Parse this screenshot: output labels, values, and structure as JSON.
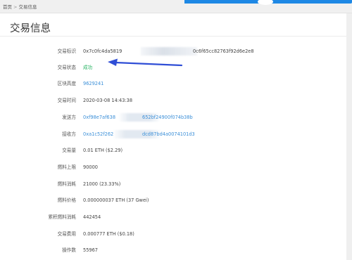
{
  "breadcrumb": {
    "home": "首页",
    "separator": ">",
    "current": "交易信息"
  },
  "page_title": "交易信息",
  "fields": {
    "tx_hash": {
      "label": "交易标识",
      "value_start": "0x7c0fc4da5819",
      "value_end": "0c6f65cc82763f92d6e2e8"
    },
    "status": {
      "label": "交易状态",
      "value": "成功"
    },
    "block_height": {
      "label": "区块高度",
      "value": "9629241"
    },
    "tx_time": {
      "label": "交易时间",
      "value": "2020-03-08 14:43:38"
    },
    "sender": {
      "label": "发送方",
      "value_start": "0xf98e7af638",
      "value_end": "652bf24900f074b38b"
    },
    "receiver": {
      "label": "接收方",
      "value_start": "0xa1c52f262",
      "value_end": "dcd87bd4a0074101d3"
    },
    "amount": {
      "label": "交易量",
      "value": "0.01 ETH ($2.29)"
    },
    "gas_limit": {
      "label": "燃料上限",
      "value": "90000"
    },
    "gas_used": {
      "label": "燃料消耗",
      "value": "21000 (23.33%)"
    },
    "gas_price": {
      "label": "燃料价格",
      "value": "0.000000037 ETH (37 Gwei)"
    },
    "cumulative_gas": {
      "label": "累积燃料消耗",
      "value": "442454"
    },
    "tx_fee": {
      "label": "交易费用",
      "value": "0.000777 ETH ($0.18)"
    },
    "nonce": {
      "label": "操作数",
      "value": "55967"
    }
  },
  "colors": {
    "link": "#3b8fd8",
    "success": "#28b463",
    "arrow": "#2f4ed6",
    "top_accent": "#1e88e5"
  }
}
